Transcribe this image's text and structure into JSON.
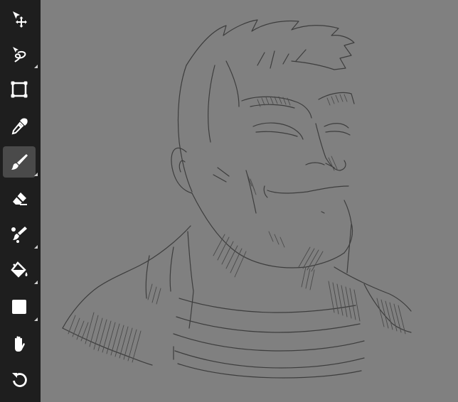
{
  "colors": {
    "toolbar_bg": "#1e1e1e",
    "active_tool_bg": "#4a4a4a",
    "canvas_bg": "#808080",
    "icon": "#ffffff",
    "sketch_stroke": "#3d3d3d"
  },
  "toolbar": {
    "tools": [
      {
        "id": "move",
        "icon": "move-selection-icon",
        "has_submenu": false
      },
      {
        "id": "lasso",
        "icon": "lasso-select-icon",
        "has_submenu": true
      },
      {
        "id": "transform",
        "icon": "transform-icon",
        "has_submenu": false
      },
      {
        "id": "eyedropper",
        "icon": "eyedropper-icon",
        "has_submenu": false
      },
      {
        "id": "brush",
        "icon": "brush-icon",
        "has_submenu": true,
        "active": true
      },
      {
        "id": "eraser",
        "icon": "eraser-icon",
        "has_submenu": false
      },
      {
        "id": "smudge",
        "icon": "smudge-icon",
        "has_submenu": true
      },
      {
        "id": "fill",
        "icon": "paint-bucket-icon",
        "has_submenu": true
      },
      {
        "id": "shape",
        "icon": "square-shape-icon",
        "has_submenu": true
      },
      {
        "id": "hand",
        "icon": "hand-pan-icon",
        "has_submenu": false
      },
      {
        "id": "undo",
        "icon": "undo-icon",
        "has_submenu": false
      }
    ]
  }
}
